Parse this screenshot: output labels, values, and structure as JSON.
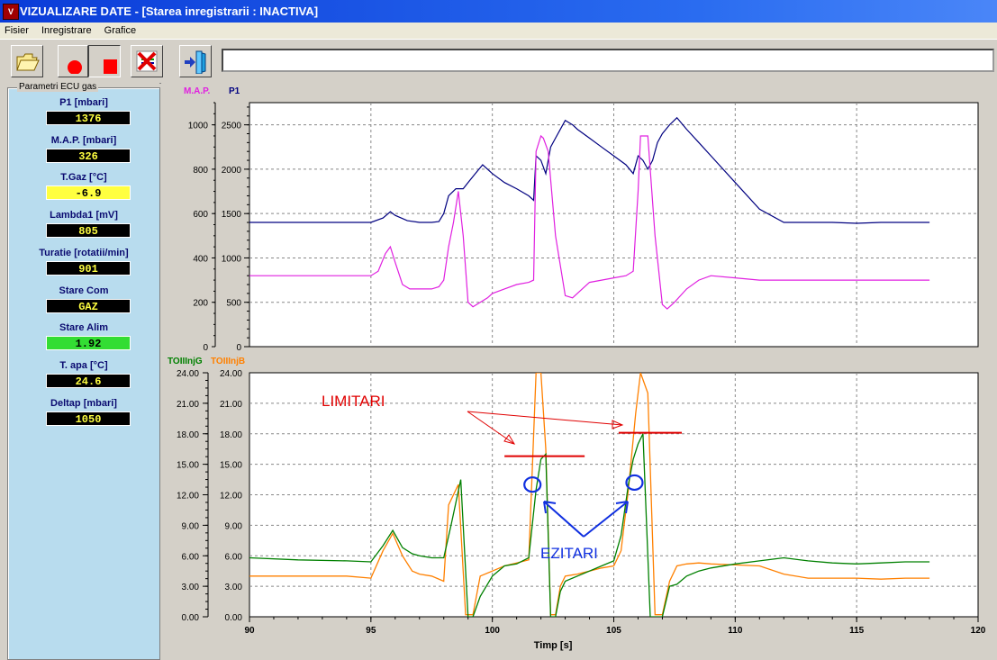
{
  "window": {
    "title": "VIZUALIZARE DATE - [Starea inregistrarii : INACTIVA]",
    "icon": "app-icon"
  },
  "menu": {
    "items": [
      "Fisier",
      "Inregistrare",
      "Grafice"
    ]
  },
  "toolbar": {
    "buttons": [
      {
        "name": "open-folder",
        "icon": "folder-icon"
      },
      {
        "name": "record",
        "icon": "record-dot-icon"
      },
      {
        "name": "stop",
        "icon": "stop-square-icon"
      },
      {
        "name": "clear",
        "icon": "delete-x-icon"
      },
      {
        "name": "exit",
        "icon": "exit-door-icon"
      }
    ],
    "status_text": ""
  },
  "left_panel": {
    "group_title": "Parametri ECU gas",
    "params": [
      {
        "label": "P1 [mbari]",
        "value": "1376",
        "bg": "#000000",
        "fg": "#ffff40"
      },
      {
        "label": "M.A.P. [mbari]",
        "value": "326",
        "bg": "#000000",
        "fg": "#ffff40"
      },
      {
        "label": "T.Gaz [°C]",
        "value": "-6.9",
        "bg": "#ffff40",
        "fg": "#000000"
      },
      {
        "label": "Lambda1 [mV]",
        "value": "805",
        "bg": "#000000",
        "fg": "#ffff40"
      },
      {
        "label": "Turatie [rotatii/min]",
        "value": "901",
        "bg": "#000000",
        "fg": "#ffff40"
      },
      {
        "label": "Stare Com",
        "value": "GAZ",
        "bg": "#000000",
        "fg": "#ffff40"
      },
      {
        "label": "Stare Alim",
        "value": "1.92",
        "bg": "#33dd33",
        "fg": "#000000"
      },
      {
        "label": "T. apa [°C]",
        "value": "24.6",
        "bg": "#000000",
        "fg": "#ffff40"
      },
      {
        "label": "Deltap [mbari]",
        "value": "1050",
        "bg": "#000000",
        "fg": "#ffff40"
      }
    ]
  },
  "charts": [
    {
      "type": "line",
      "legend": [
        {
          "name": "M.A.P.",
          "color": "#e020e0"
        },
        {
          "name": "P1",
          "color": "#000080"
        }
      ],
      "xlim": [
        90,
        120
      ],
      "y_left_ticks": [
        "0",
        "200",
        "400",
        "600",
        "800",
        "1000"
      ],
      "y_right_ticks": [
        "0",
        "500",
        "1000",
        "1500",
        "2000",
        "2500"
      ],
      "y_left_max": 1100,
      "y_right_max": 2750,
      "series": [
        {
          "name": "P1",
          "axis": "right",
          "color": "#000080",
          "x": [
            90,
            92,
            94,
            95,
            95.5,
            95.8,
            96,
            96.5,
            97,
            97.5,
            97.8,
            98,
            98.2,
            98.5,
            98.8,
            99,
            99.3,
            99.6,
            100,
            100.5,
            101,
            101.5,
            101.7,
            101.8,
            102,
            102.2,
            102.4,
            102.6,
            102.8,
            103,
            103.3,
            103.5,
            104,
            104.5,
            105,
            105.5,
            105.8,
            106,
            106.2,
            106.4,
            106.6,
            106.8,
            107,
            107.3,
            107.6,
            108,
            108.5,
            109,
            110,
            111,
            112,
            113,
            114,
            115,
            116,
            117,
            118
          ],
          "y": [
            1400,
            1400,
            1400,
            1400,
            1450,
            1520,
            1480,
            1420,
            1400,
            1400,
            1410,
            1500,
            1700,
            1780,
            1780,
            1850,
            1950,
            2050,
            1950,
            1850,
            1780,
            1700,
            1650,
            2150,
            2100,
            1950,
            2250,
            2350,
            2450,
            2550,
            2500,
            2450,
            2350,
            2250,
            2150,
            2050,
            1950,
            2150,
            2100,
            2000,
            2100,
            2300,
            2400,
            2500,
            2580,
            2450,
            2300,
            2150,
            1850,
            1550,
            1400,
            1400,
            1400,
            1390,
            1400,
            1400,
            1400
          ]
        },
        {
          "name": "M.A.P.",
          "axis": "left",
          "color": "#e020e0",
          "x": [
            90,
            92,
            94,
            95,
            95.3,
            95.6,
            95.8,
            96,
            96.3,
            96.6,
            97,
            97.5,
            97.8,
            98,
            98.2,
            98.4,
            98.6,
            98.8,
            99,
            99.2,
            99.5,
            99.8,
            100,
            100.5,
            101,
            101.5,
            101.7,
            101.8,
            102,
            102.1,
            102.3,
            102.6,
            103,
            103.3,
            103.6,
            104,
            104.5,
            105,
            105.5,
            105.8,
            106,
            106.1,
            106.4,
            106.7,
            107,
            107.2,
            107.5,
            108,
            108.5,
            109,
            110,
            111,
            112,
            113,
            114,
            115,
            116,
            117,
            118
          ],
          "y": [
            320,
            320,
            320,
            320,
            340,
            420,
            450,
            380,
            280,
            260,
            260,
            260,
            270,
            300,
            450,
            560,
            700,
            500,
            200,
            180,
            200,
            220,
            240,
            260,
            280,
            290,
            300,
            880,
            950,
            940,
            880,
            500,
            230,
            220,
            250,
            290,
            300,
            310,
            320,
            340,
            700,
            950,
            950,
            500,
            190,
            170,
            200,
            260,
            300,
            320,
            310,
            300,
            300,
            300,
            300,
            300,
            300,
            300,
            300
          ]
        }
      ]
    },
    {
      "type": "line",
      "legend": [
        {
          "name": "TOIIInjG",
          "color": "#008000"
        },
        {
          "name": "TOIIInjB",
          "color": "#ff8000"
        }
      ],
      "xlim": [
        90,
        120
      ],
      "ylim": [
        0,
        24
      ],
      "x_ticks": [
        "90",
        "95",
        "100",
        "105",
        "110",
        "115",
        "120"
      ],
      "y_ticks": [
        "0.00",
        "3.00",
        "6.00",
        "9.00",
        "12.00",
        "15.00",
        "18.00",
        "21.00",
        "24.00"
      ],
      "xlabel": "Timp [s]",
      "series": [
        {
          "name": "TOIIInjG",
          "color": "#008000",
          "x": [
            90,
            92,
            94,
            95,
            95.5,
            95.9,
            96.3,
            96.7,
            97,
            97.5,
            98,
            98.3,
            98.7,
            99,
            99.2,
            99.5,
            100,
            100.5,
            101,
            101.5,
            101.8,
            102,
            102.2,
            102.4,
            102.6,
            102.8,
            103,
            103.5,
            104,
            104.5,
            105,
            105.3,
            105.6,
            105.8,
            106,
            106.2,
            106.5,
            106.7,
            107,
            107.3,
            107.6,
            108,
            108.5,
            109,
            110,
            111,
            112,
            113,
            114,
            115,
            116,
            117,
            118
          ],
          "y": [
            5.8,
            5.6,
            5.5,
            5.4,
            7,
            8.5,
            6.8,
            6.2,
            6,
            5.8,
            5.8,
            9,
            13.5,
            0,
            0,
            2,
            4,
            5,
            5.2,
            5.8,
            12.5,
            15.5,
            16,
            0,
            0,
            2.5,
            3.5,
            4,
            4.5,
            5,
            5.5,
            8,
            13,
            15.5,
            17,
            18,
            0,
            0,
            0,
            3,
            3.2,
            4,
            4.5,
            4.8,
            5.2,
            5.5,
            5.8,
            5.5,
            5.3,
            5.2,
            5.3,
            5.4,
            5.4
          ]
        },
        {
          "name": "TOIIInjB",
          "color": "#ff8000",
          "x": [
            90,
            92,
            94,
            95,
            95.5,
            95.9,
            96.3,
            96.7,
            97,
            97.5,
            98,
            98.2,
            98.6,
            98.9,
            99.2,
            99.5,
            100,
            100.5,
            101,
            101.5,
            101.8,
            102,
            102.2,
            102.4,
            102.6,
            102.8,
            103,
            103.5,
            104,
            104.5,
            105,
            105.3,
            105.6,
            105.9,
            106.1,
            106.4,
            106.7,
            107,
            107.3,
            107.6,
            108,
            108.5,
            109,
            110,
            111,
            112,
            113,
            114,
            115,
            116,
            117,
            118
          ],
          "y": [
            4,
            4,
            4,
            3.8,
            6.5,
            8.2,
            6,
            4.5,
            4.2,
            4,
            3.5,
            11,
            13,
            0.2,
            0.2,
            4,
            4.5,
            5,
            5.3,
            5.6,
            24,
            24,
            16.5,
            0.2,
            0.2,
            3,
            4,
            4.2,
            4.5,
            4.8,
            5,
            6.5,
            12.5,
            20,
            24,
            22,
            0.2,
            0.2,
            3.5,
            5,
            5.2,
            5.3,
            5.2,
            5.1,
            5,
            4.2,
            3.8,
            3.8,
            3.8,
            3.7,
            3.8,
            3.8,
            3.9
          ]
        }
      ],
      "annotations": {
        "limitari_text": "LIMITARI",
        "ezitari_text": "EZITARI",
        "limit_lines": [
          {
            "x1": 100.5,
            "x2": 103.8,
            "y": 15.8
          },
          {
            "x1": 105.2,
            "x2": 107.8,
            "y": 18.1
          }
        ],
        "circles": [
          {
            "x": 101.8,
            "y": 13.0
          },
          {
            "x": 106.0,
            "y": 13.2
          }
        ]
      }
    }
  ]
}
